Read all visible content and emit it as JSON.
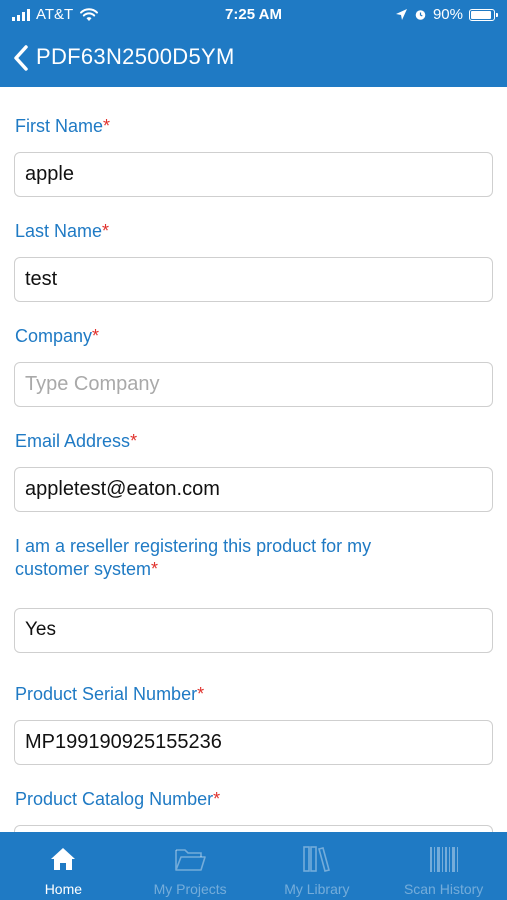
{
  "status_bar": {
    "carrier": "AT&T",
    "time": "7:25 AM",
    "battery": "90%",
    "battery_level": 0.9
  },
  "nav": {
    "title": "PDF63N2500D5YM"
  },
  "form": {
    "first_name": {
      "label": "First Name",
      "required": "*",
      "value": "apple"
    },
    "last_name": {
      "label": "Last Name",
      "required": "*",
      "value": "test"
    },
    "company": {
      "label": "Company",
      "required": "*",
      "placeholder": "Type Company"
    },
    "email": {
      "label": "Email Address",
      "required": "*",
      "value": "appletest@eaton.com"
    },
    "reseller": {
      "label_line1": "I am a reseller registering this product for my",
      "label_line2": "customer system",
      "required": "*",
      "value": "Yes"
    },
    "serial": {
      "label": "Product Serial Number",
      "required": "*",
      "value": "MP199190925155236"
    },
    "catalog": {
      "label": "Product Catalog Number",
      "required": "*"
    }
  },
  "tabs": [
    {
      "label": "Home",
      "icon": "home-icon",
      "active": true
    },
    {
      "label": "My Projects",
      "icon": "folder-icon",
      "active": false
    },
    {
      "label": "My Library",
      "icon": "library-icon",
      "active": false
    },
    {
      "label": "Scan History",
      "icon": "barcode-icon",
      "active": false
    }
  ],
  "colors": {
    "brand": "#1f7ac4",
    "required": "#e0302b",
    "placeholder": "#a9a9a9",
    "field_border": "#cfcfcf"
  }
}
